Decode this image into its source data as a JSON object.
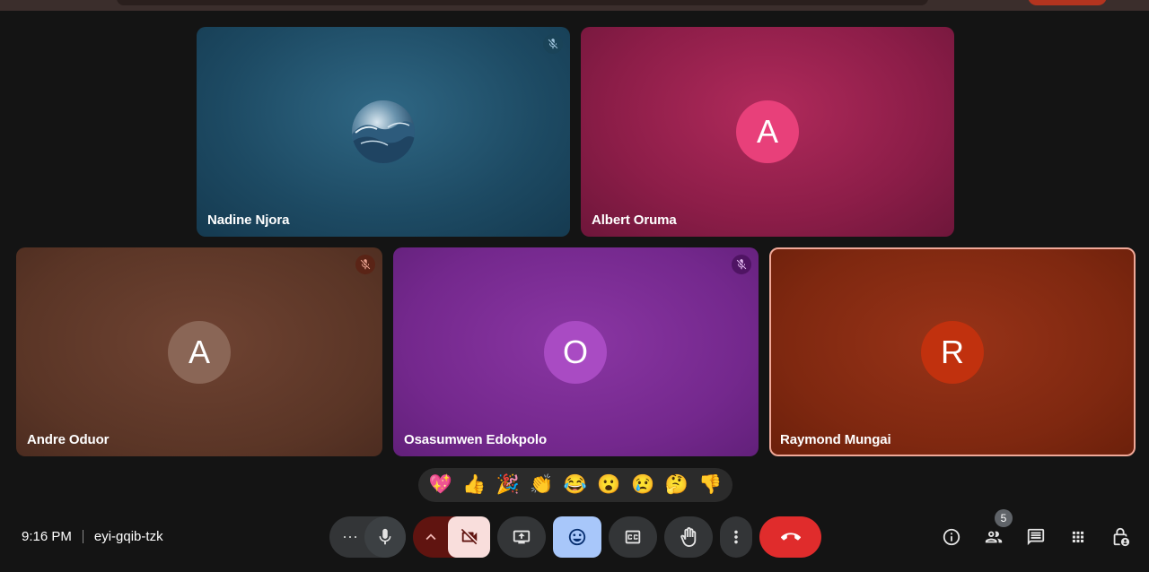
{
  "meeting": {
    "time": "9:16 PM",
    "code": "eyi-gqib-tzk"
  },
  "participants": [
    {
      "name": "Nadine Njora",
      "initial": "",
      "muted": true
    },
    {
      "name": "Albert Oruma",
      "initial": "A",
      "muted": false
    },
    {
      "name": "Andre Oduor",
      "initial": "A",
      "muted": true
    },
    {
      "name": "Osasumwen Edokpolo",
      "initial": "O",
      "muted": true
    },
    {
      "name": "Raymond Mungai",
      "initial": "R",
      "muted": false
    }
  ],
  "reactions": [
    "💖",
    "👍",
    "🎉",
    "👏",
    "😂",
    "😮",
    "😢",
    "🤔",
    "👎"
  ],
  "people_count": "5",
  "controls": {
    "more_audio_label": "⋯",
    "chevron_label": "^"
  },
  "colors": {
    "avatar_albert": "#e8407a",
    "avatar_andre": "#8a6656",
    "avatar_osasumwen": "#a94bc3",
    "avatar_raymond": "#c1310e",
    "end_call": "#e02c2c",
    "reactions_active": "#a8c7fa",
    "camera_off": "#f9dedc"
  }
}
